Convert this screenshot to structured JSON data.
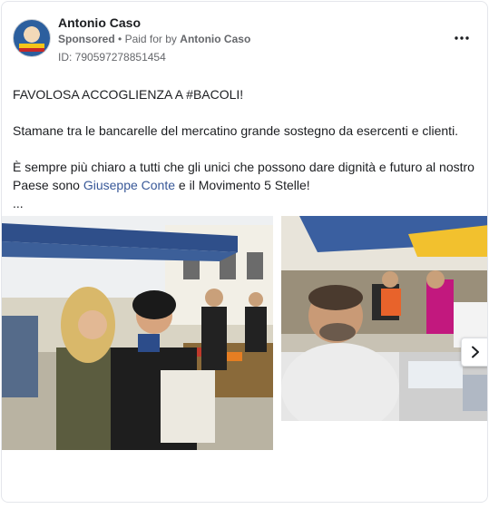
{
  "post": {
    "author": "Antonio Caso",
    "sponsored_label": "Sponsored",
    "separator": "•",
    "paid_for_prefix": "Paid for by",
    "paid_for_name": "Antonio Caso",
    "ad_id": "ID: 790597278851454"
  },
  "body": {
    "line1": "FAVOLOSA ACCOGLIENZA A #BACOLI!",
    "line2": "Stamane tra le bancarelle del mercatino grande sostegno da esercenti e clienti.",
    "line3_start": "È sempre più chiaro a tutti che gli unici che possono dare dignità e futuro al nostro Paese sono ",
    "line3_link": "Giuseppe Conte",
    "line3_end": " e il Movimento 5 Stelle!",
    "ellipsis": "..."
  },
  "icons": {
    "more": "more-horizontal-icon",
    "next": "chevron-right-icon"
  },
  "colors": {
    "link": "#385898",
    "secondary_text": "#65676b",
    "border": "#e4e6eb"
  }
}
